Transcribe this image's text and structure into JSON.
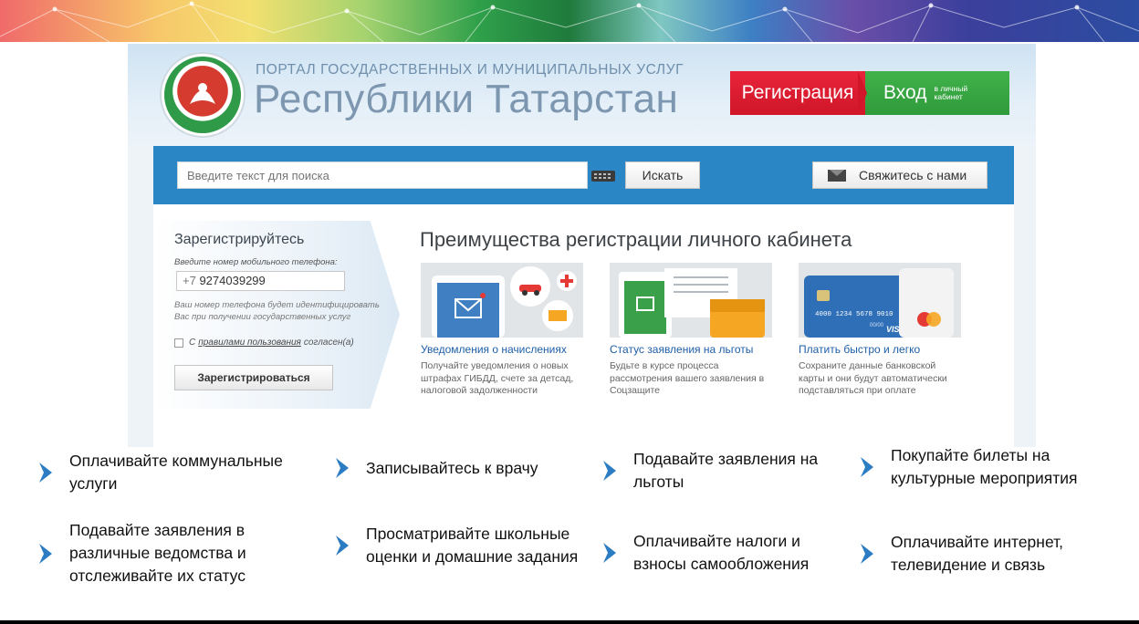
{
  "header": {
    "portal_subtitle": "ПОРТАЛ ГОСУДАРСТВЕННЫХ И МУНИЦИПАЛЬНЫХ УСЛУГ",
    "portal_title": "Республики Татарстан",
    "register_label": "Регистрация",
    "login_label": "Вход",
    "login_sub": "в личный кабинет"
  },
  "search": {
    "placeholder": "Введите текст для поиска",
    "button_label": "Искать",
    "contact_label": "Свяжитесь с нами"
  },
  "registration": {
    "title": "Зарегистрируйтесь",
    "phone_hint": "Введите номер мобильного телефона:",
    "phone_prefix": "+7",
    "phone_value": "9274039299",
    "note": "Ваш номер телефона будет идентифицировать Вас при получении государственных услуг",
    "agree_prefix": "С",
    "agree_link": "правилами пользования",
    "agree_suffix": "согласен(а)",
    "button_label": "Зарегистрироваться"
  },
  "advantages": {
    "title": "Преимущества регистрации личного кабинета",
    "cards": [
      {
        "title": "Уведомления о начислениях",
        "desc": "Получайте уведомления о новых штрафах ГИБДД, счете за детсад, налоговой задолженности"
      },
      {
        "title": "Статус заявления на льготы",
        "desc": "Будьте в курсе процесса рассмотрения вашего заявления в Соцзащите"
      },
      {
        "title": "Платить быстро и легко",
        "desc": "Сохраните данные банковской карты и они будут автоматически подставляться при оплате"
      }
    ],
    "card_number": "4000 1234 5678 9010",
    "card_exp": "00/00",
    "card_brand": "VISA"
  },
  "features": [
    {
      "text": "Оплачивайте коммунальные услуги"
    },
    {
      "text": "Записывайтесь к врачу"
    },
    {
      "text": "Подавайте заявления на льготы"
    },
    {
      "text": "Покупайте билеты на культурные мероприятия"
    },
    {
      "text": "Подавайте заявления в различные ведомства и отслеживайте их статус"
    },
    {
      "text": "Просматривайте школьные оценки и домашние задания"
    },
    {
      "text": "Оплачивайте налоги и взносы самообложения"
    },
    {
      "text": "Оплачивайте интернет, телевидение и связь"
    }
  ],
  "colors": {
    "accent_blue": "#2b86c6",
    "register_red": "#e8243a",
    "login_green": "#41b24a",
    "link_blue": "#1f5fa8",
    "chevron_blue": "#2b7cc2"
  },
  "icons": [
    "logo-emblem",
    "keyboard-icon",
    "envelope-icon",
    "chevron-right-icon"
  ]
}
